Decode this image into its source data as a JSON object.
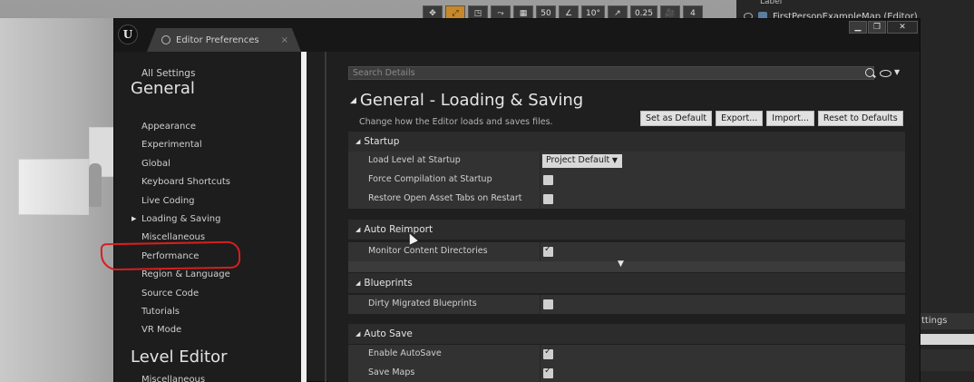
{
  "viewport_toolbar": {
    "snap_value": "50",
    "rotation_value": "10°",
    "scale_value": "0.25",
    "camera_speed": "4"
  },
  "outliner": {
    "header": "Label",
    "row_label": "FirstPersonExampleMap (Editor)",
    "details_tab": "ttings"
  },
  "window": {
    "logo": "U",
    "tab_label": "Editor Preferences",
    "tab_close": "×",
    "controls": [
      "▁",
      "❐",
      "✕"
    ]
  },
  "sidebar": {
    "all_settings": "All Settings",
    "general_heading": "General",
    "general_items": [
      "Appearance",
      "Experimental",
      "Global",
      "Keyboard Shortcuts",
      "Live Coding",
      "Loading & Saving",
      "Miscellaneous",
      "Performance",
      "Region & Language",
      "Source Code",
      "Tutorials",
      "VR Mode"
    ],
    "active_index": 5,
    "level_editor_heading": "Level Editor",
    "level_editor_items": [
      "Miscellaneous"
    ]
  },
  "details": {
    "search_placeholder": "Search Details",
    "title": "General - Loading & Saving",
    "description": "Change how the Editor loads and saves files.",
    "buttons": {
      "set_default": "Set as Default",
      "export": "Export...",
      "import": "Import...",
      "reset": "Reset to Defaults"
    },
    "categories": {
      "startup": {
        "title": "Startup",
        "load_level_label": "Load Level at Startup",
        "load_level_value": "Project Default",
        "force_compile_label": "Force Compilation at Startup",
        "force_compile_checked": false,
        "restore_tabs_label": "Restore Open Asset Tabs on Restart",
        "restore_tabs_checked": false
      },
      "auto_reimport": {
        "title": "Auto Reimport",
        "monitor_label": "Monitor Content Directories",
        "monitor_checked": true
      },
      "blueprints": {
        "title": "Blueprints",
        "dirty_label": "Dirty Migrated Blueprints",
        "dirty_checked": false
      },
      "auto_save": {
        "title": "Auto Save",
        "enable_label": "Enable AutoSave",
        "enable_checked": true,
        "save_maps_label": "Save Maps",
        "save_maps_checked": true
      }
    }
  },
  "colors": {
    "accent_highlight": "#d32020",
    "window_bg": "#1f1f1f",
    "category_bg": "#2c2c2c",
    "row_bg": "#323232"
  }
}
